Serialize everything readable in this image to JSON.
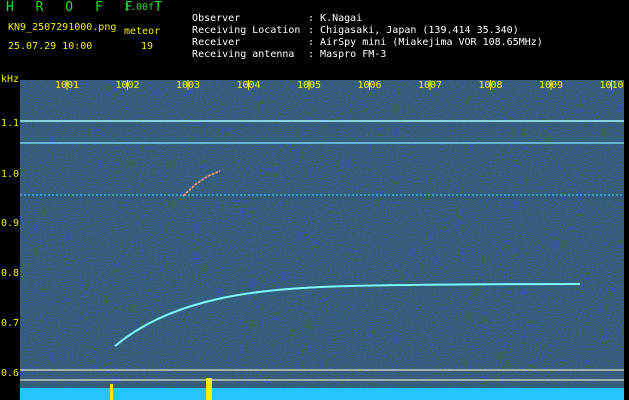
{
  "header": {
    "app_title": "H R O F F T",
    "version": "1.00f",
    "filename": "KN9_2507291000.png",
    "meteor_label": "meteor",
    "datetime": "25.07.29 10:00",
    "meteor_count": "19",
    "info": [
      {
        "label": "Observer",
        "value": "K.Nagai"
      },
      {
        "label": "Receiving Location",
        "value": "Chigasaki, Japan (139.414 35.340)"
      },
      {
        "label": "Receiver",
        "value": "AirSpy mini (Miakejima VOR 108.65MHz)"
      },
      {
        "label": "Receiving antenna",
        "value": "Maspro FM-3"
      }
    ],
    "separator": ":"
  },
  "axes": {
    "y_unit": "kHz",
    "x_ticks": [
      "1001",
      "1002",
      "1003",
      "1004",
      "1005",
      "1006",
      "1007",
      "1008",
      "1009",
      "1010"
    ],
    "y_ticks": [
      "1.1",
      "1.0",
      "0.9",
      "0.8",
      "0.7",
      "0.6"
    ]
  },
  "colors": {
    "background_noise": "#00107a",
    "signal": "#80ffff",
    "label_yellow": "#f4f000",
    "title_green": "#20e020"
  }
}
